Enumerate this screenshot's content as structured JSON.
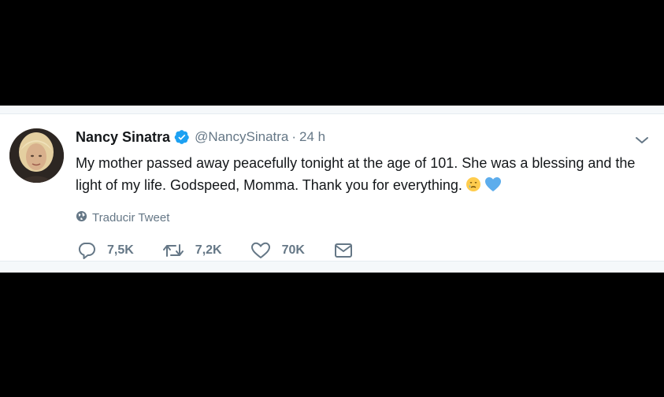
{
  "tweet": {
    "display_name": "Nancy Sinatra",
    "handle": "@NancySinatra",
    "separator": "·",
    "time": "24 h",
    "text": "My mother passed away peacefully tonight at the age of 101. She was a blessing and the light of my life. Godspeed, Momma. Thank you for everything.",
    "translate_label": "Traducir Tweet",
    "emojis": [
      "crying-face-emoji",
      "blue-heart-emoji"
    ]
  },
  "actions": {
    "reply_count": "7,5K",
    "retweet_count": "7,2K",
    "like_count": "70K"
  },
  "icons": {
    "verified": "verified-badge-icon",
    "caret": "chevron-down-icon",
    "globe": "globe-icon",
    "reply": "reply-icon",
    "retweet": "retweet-icon",
    "like": "heart-icon",
    "dm": "mail-icon"
  },
  "colors": {
    "verified_blue": "#1da1f2",
    "secondary_text": "#657786",
    "primary_text": "#14171a",
    "background_outer": "#000000"
  }
}
